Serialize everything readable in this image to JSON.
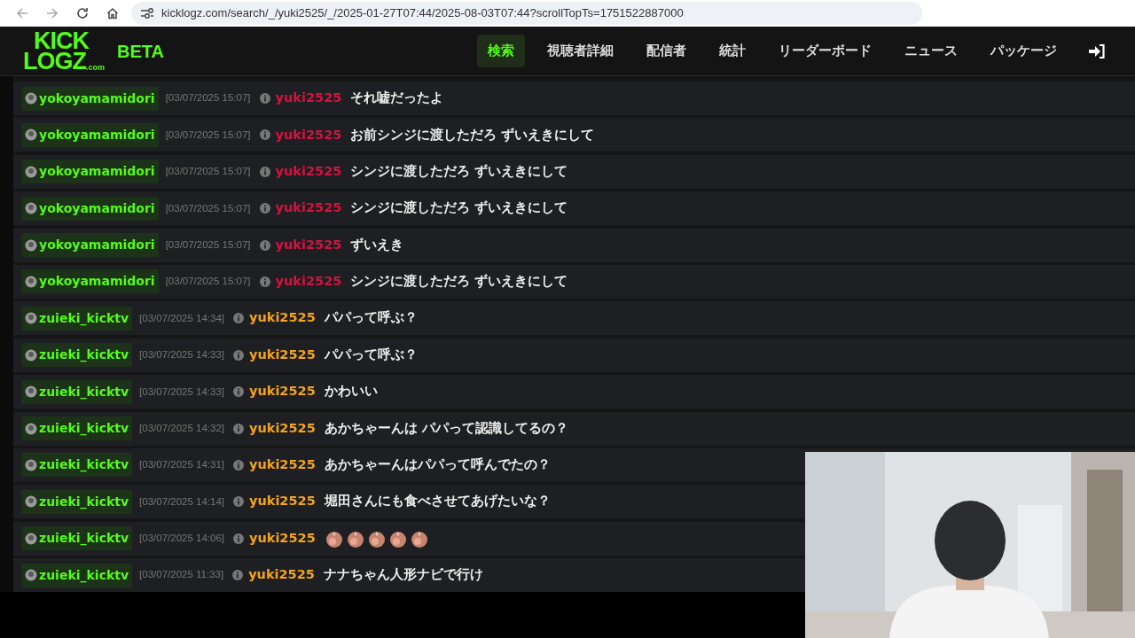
{
  "browser": {
    "url": "kicklogz.com/search/_/yuki2525/_/2025-01-27T07:44/2025-08-03T07:44?scrollTopTs=1751522887000"
  },
  "brand": {
    "logo_top": "KICK",
    "logo_bottom": "LOGZ",
    "logo_suffix": ".com",
    "tag": "BETA"
  },
  "nav": [
    {
      "label": "検索",
      "selected": true
    },
    {
      "label": "視聴者詳細",
      "selected": false
    },
    {
      "label": "配信者",
      "selected": false
    },
    {
      "label": "統計",
      "selected": false
    },
    {
      "label": "リーダーボード",
      "selected": false
    },
    {
      "label": "ニュース",
      "selected": false
    },
    {
      "label": "パッケージ",
      "selected": false
    }
  ],
  "messages": [
    {
      "channel": "yokoyamamidori",
      "time": "[03/07/2025 15:07]",
      "user": "yuki2525",
      "color": "#d5123f",
      "kind": "text",
      "text": "それ嘘だったよ"
    },
    {
      "channel": "yokoyamamidori",
      "time": "[03/07/2025 15:07]",
      "user": "yuki2525",
      "color": "#d5123f",
      "kind": "text",
      "text": "お前シンジに渡しただろ ずいえきにして"
    },
    {
      "channel": "yokoyamamidori",
      "time": "[03/07/2025 15:07]",
      "user": "yuki2525",
      "color": "#d5123f",
      "kind": "text",
      "text": "シンジに渡しただろ ずいえきにして"
    },
    {
      "channel": "yokoyamamidori",
      "time": "[03/07/2025 15:07]",
      "user": "yuki2525",
      "color": "#d5123f",
      "kind": "text",
      "text": "シンジに渡しただろ ずいえきにして"
    },
    {
      "channel": "yokoyamamidori",
      "time": "[03/07/2025 15:07]",
      "user": "yuki2525",
      "color": "#d5123f",
      "kind": "text",
      "text": "ずいえき"
    },
    {
      "channel": "yokoyamamidori",
      "time": "[03/07/2025 15:07]",
      "user": "yuki2525",
      "color": "#d5123f",
      "kind": "text",
      "text": "シンジに渡しただろ ずいえきにして"
    },
    {
      "channel": "zuieki_kicktv",
      "time": "[03/07/2025 14:34]",
      "user": "yuki2525",
      "color": "#f3a31d",
      "kind": "text",
      "text": "パパって呼ぶ？"
    },
    {
      "channel": "zuieki_kicktv",
      "time": "[03/07/2025 14:33]",
      "user": "yuki2525",
      "color": "#f3a31d",
      "kind": "text",
      "text": "パパって呼ぶ？"
    },
    {
      "channel": "zuieki_kicktv",
      "time": "[03/07/2025 14:33]",
      "user": "yuki2525",
      "color": "#f3a31d",
      "kind": "text",
      "text": "かわいい"
    },
    {
      "channel": "zuieki_kicktv",
      "time": "[03/07/2025 14:32]",
      "user": "yuki2525",
      "color": "#f3a31d",
      "kind": "text",
      "text": "あかちゃーんは パパって認識してるの？"
    },
    {
      "channel": "zuieki_kicktv",
      "time": "[03/07/2025 14:31]",
      "user": "yuki2525",
      "color": "#f3a31d",
      "kind": "text",
      "text": "あかちゃーんはパパって呼んでたの？"
    },
    {
      "channel": "zuieki_kicktv",
      "time": "[03/07/2025 14:14]",
      "user": "yuki2525",
      "color": "#f3a31d",
      "kind": "text",
      "text": "堀田さんにも食べさせてあげたいな？"
    },
    {
      "channel": "zuieki_kicktv",
      "time": "[03/07/2025 14:06]",
      "user": "yuki2525",
      "color": "#f3a31d",
      "kind": "emotes",
      "emotes": [
        {
          "kind": "emote"
        },
        {
          "kind": "emote"
        },
        {
          "kind": "emote"
        },
        {
          "kind": "emote"
        },
        {
          "kind": "emote"
        }
      ]
    },
    {
      "channel": "zuieki_kicktv",
      "time": "[03/07/2025 11:33]",
      "user": "yuki2525",
      "color": "#f3a31d",
      "kind": "text",
      "text": "ナナちゃん人形ナビで行け"
    }
  ]
}
